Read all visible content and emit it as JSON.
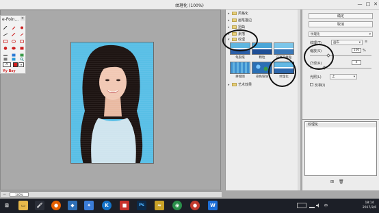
{
  "window": {
    "title": "纹理化 (100%)",
    "minimize_glyph": "—",
    "maximize_glyph": "□",
    "close_glyph": "✕"
  },
  "canvas": {
    "zoom": "100%"
  },
  "palette": {
    "title": "e-Poin...",
    "close_glyph": "×",
    "tool_icons": [
      "pen-icon",
      "dropper-icon",
      "brush-icon",
      "line-icon",
      "brush2-icon",
      "eraser-icon",
      "rect-icon",
      "ellipse-icon",
      "rounded-rect-icon",
      "filled-circle-icon",
      "filled-ellipse-icon",
      "filled-rect-icon",
      "line2-icon",
      "arrow-icon",
      "text-icon",
      "screen-icon",
      "image-icon",
      "magnifier-icon"
    ],
    "selected_tool": "A",
    "dropdown_glyph": "▾",
    "brand": "Yy Bsy",
    "accent_color": "#d32020"
  },
  "gallery": {
    "categories": [
      {
        "label": "风格化",
        "expanded": false
      },
      {
        "label": "画笔描边",
        "expanded": false
      },
      {
        "label": "扭曲",
        "expanded": false
      },
      {
        "label": "素描",
        "expanded": false
      },
      {
        "label": "纹理",
        "expanded": true
      },
      {
        "label": "艺术效果",
        "expanded": false
      }
    ],
    "thumbnails": [
      {
        "label": "龟裂缝",
        "icon": "craquelure-thumb"
      },
      {
        "label": "颗粒",
        "icon": "grain-thumb"
      },
      {
        "label": "马赛克拼贴",
        "icon": "mosaic-tiles-thumb"
      },
      {
        "label": "拼缀图",
        "icon": "patchwork-thumb"
      },
      {
        "label": "染色玻璃",
        "icon": "stained-glass-thumb"
      },
      {
        "label": "纹理化",
        "icon": "texturizer-thumb",
        "selected": true
      }
    ]
  },
  "settings": {
    "ok_label": "确定",
    "cancel_label": "取消",
    "filter_select": "纹理化",
    "texture_label": "纹理(T)",
    "texture_value": "画布",
    "scaling_label": "缩放(S)",
    "scaling_value": "100",
    "scaling_unit": "%",
    "relief_label": "凸现(R)",
    "relief_value": "4",
    "light_label": "光照(L)",
    "light_value": "上",
    "invert_label": "反相(I)"
  },
  "layers": {
    "items": [
      {
        "label": "纹理化"
      }
    ],
    "new_layer_glyph": "⊞",
    "delete_layer_glyph": "🗑"
  },
  "taskbar": {
    "apps": [
      {
        "name": "windows-start-icon",
        "glyph": "⊞",
        "color": "#1c1f27"
      },
      {
        "name": "file-explorer-icon",
        "glyph": "▭",
        "color": "#e8b84a"
      },
      {
        "name": "paint-icon",
        "glyph": "🖌",
        "color": "#2a2e38"
      },
      {
        "name": "firefox-icon",
        "glyph": "●",
        "color": "#e66000"
      },
      {
        "name": "thunderbird-icon",
        "glyph": "◆",
        "color": "#2e6fb6"
      },
      {
        "name": "bird-icon",
        "glyph": "✦",
        "color": "#3b7dd8"
      },
      {
        "name": "k-app-icon",
        "glyph": "K",
        "color": "#1473c8"
      },
      {
        "name": "red-app-icon",
        "glyph": "■",
        "color": "#c8312b"
      },
      {
        "name": "photoshop-icon",
        "glyph": "Ps",
        "color": "#0b2a4a"
      },
      {
        "name": "yellow-app-icon",
        "glyph": "≈",
        "color": "#c9a227"
      },
      {
        "name": "chrome-icon",
        "glyph": "◉",
        "color": "#2a8f4a"
      },
      {
        "name": "media-app-icon",
        "glyph": "●",
        "color": "#c23b2e"
      },
      {
        "name": "wps-icon",
        "glyph": "W",
        "color": "#1d6fd8"
      }
    ],
    "language": "中",
    "time": "18:14",
    "date": "2017/3/6"
  }
}
